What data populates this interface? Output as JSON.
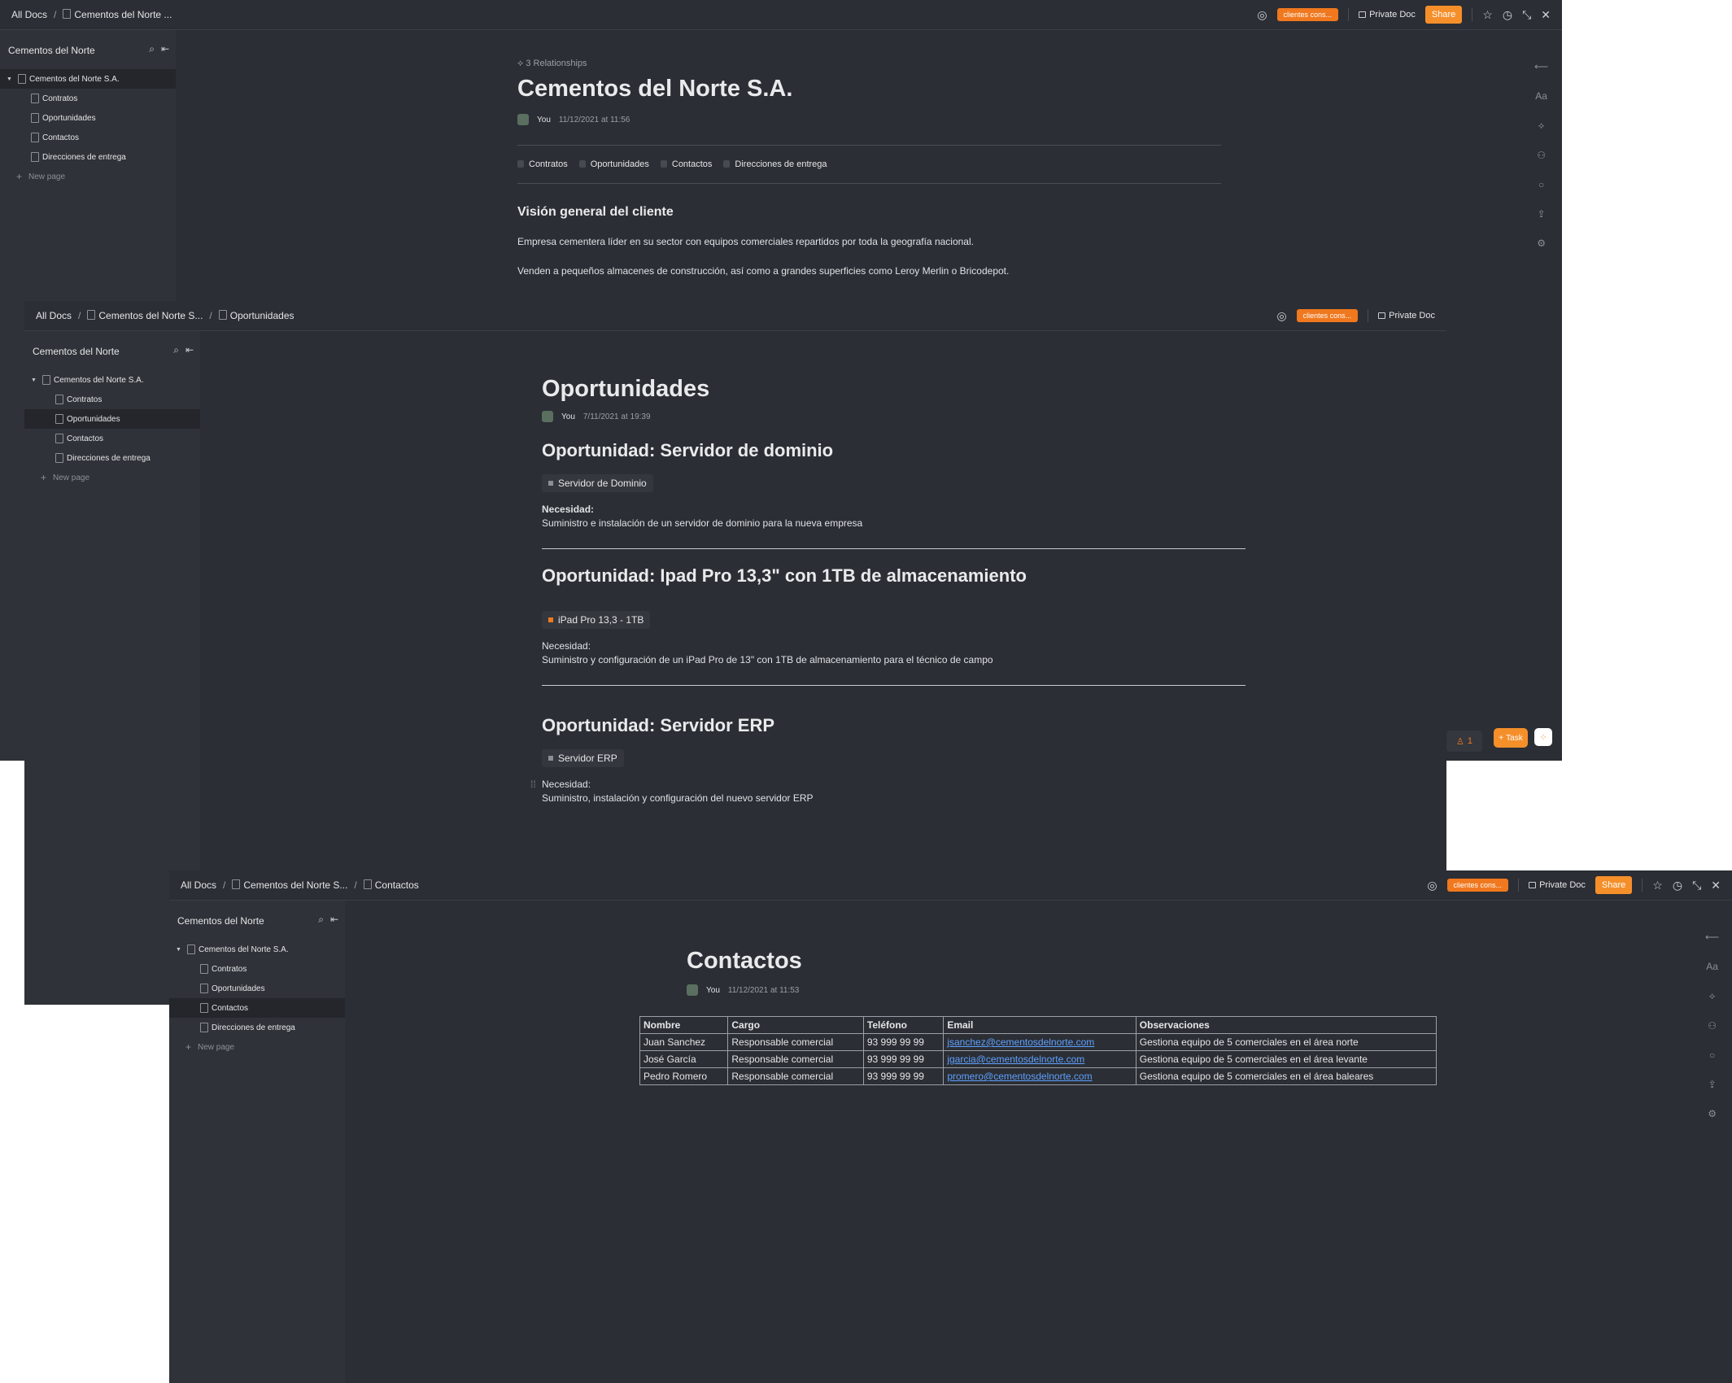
{
  "common": {
    "all_docs": "All Docs",
    "status_chip": "clientes cons...",
    "private_doc": "Private Doc",
    "share": "Share",
    "workspace": "Cementos del Norte",
    "new_page": "New page",
    "author": "You",
    "tree": {
      "root": "Cementos del Norte S.A.",
      "children": [
        "Contratos",
        "Oportunidades",
        "Contactos",
        "Direcciones de entrega"
      ]
    },
    "icons": {
      "search": "search-icon",
      "collapse": "collapse-sidebar-icon",
      "star": "star-icon",
      "history": "history-icon",
      "minimize": "minimize-icon",
      "close": "close-icon"
    },
    "accent": "#f58f2a"
  },
  "w1": {
    "breadcrumb": [
      "Cementos del Norte ..."
    ],
    "relationships": "3 Relationships",
    "title": "Cementos del Norte S.A.",
    "date": "11/12/2021 at 11:56",
    "relations": [
      "Contratos",
      "Oportunidades",
      "Contactos",
      "Direcciones de entrega"
    ],
    "section_title": "Visión general del cliente",
    "paragraphs": [
      "Empresa cementera líder en su sector con equipos comerciales repartidos por toda la geografía nacional.",
      "Venden a pequeños almacenes de construcción, así como a grandes superficies como Leroy Merlin o Bricodepot."
    ],
    "task_label": "Task",
    "users_badge": "1"
  },
  "w2": {
    "breadcrumb": [
      "Cementos del Norte S...",
      "Oportunidades"
    ],
    "title": "Oportunidades",
    "date": "7/11/2021 at 19:39",
    "opportunities": [
      {
        "heading": "Oportunidad: Servidor de dominio",
        "tag": "Servidor de Dominio",
        "tag_color": "#8a8f96",
        "need_label": "Necesidad:",
        "need": "Suministro e instalación de un servidor de dominio para la nueva empresa"
      },
      {
        "heading": "Oportunidad: Ipad Pro 13,3\" con 1TB de almacenamiento",
        "tag": "iPad Pro 13,3 - 1TB",
        "tag_color": "#f0781e",
        "need_label": "Necesidad:",
        "need": "Suministro y configuración de un iPad Pro de 13\" con 1TB de almacenamiento para el técnico de campo"
      },
      {
        "heading": "Oportunidad: Servidor ERP",
        "tag": "Servidor ERP",
        "tag_color": "#8a8f96",
        "need_label": "Necesidad:",
        "need": "Suministro, instalación y configuración del nuevo servidor ERP"
      }
    ]
  },
  "w3": {
    "breadcrumb": [
      "Cementos del Norte S...",
      "Contactos"
    ],
    "title": "Contactos",
    "date": "11/12/2021 at 11:53",
    "table": {
      "headers": [
        "Nombre",
        "Cargo",
        "Teléfono",
        "Email",
        "Observaciones"
      ],
      "rows": [
        [
          "Juan Sanchez",
          "Responsable comercial",
          "93 999 99 99",
          "jsanchez@cementosdelnorte.com",
          "Gestiona equipo de 5 comerciales en el área norte"
        ],
        [
          "José García",
          "Responsable comercial",
          "93 999 99 99",
          "jgarcia@cementosdelnorte.com",
          "Gestiona equipo de 5 comerciales en el área levante"
        ],
        [
          "Pedro Romero",
          "Responsable comercial",
          "93 999 99 99",
          "promero@cementosdelnorte.com",
          "Gestiona equipo de 5 comerciales en el área baleares"
        ]
      ]
    }
  }
}
